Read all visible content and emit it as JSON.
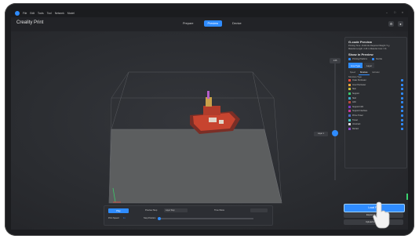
{
  "menubar": {
    "items": [
      "File",
      "Edit",
      "Tools",
      "Tool",
      "Network",
      "Model"
    ]
  },
  "toolbar": {
    "title": "Creality Print",
    "tabs": [
      {
        "label": "Prepare",
        "active": false
      },
      {
        "label": "Preview",
        "active": true
      },
      {
        "label": "Device",
        "active": false
      }
    ]
  },
  "side_panel": {
    "title": "G-code Preview",
    "info_line1": "Printing Time: 1h13m3s   Required Weight: 5.g",
    "info_line2": "Material Length: 2.26 m   Material Cost: 0 $",
    "show_title": "Show in Preview",
    "show_options": [
      {
        "label": "Printing Platform"
      },
      {
        "label": "Nozzle"
      }
    ],
    "scheme_tabs": [
      {
        "label": "Line Type",
        "active": true
      },
      {
        "label": "Layer",
        "active": false
      }
    ],
    "sub_tabs": [
      {
        "label": "Speed",
        "active": false
      },
      {
        "label": "Structure",
        "active": true
      },
      {
        "label": "Extruder",
        "active": false
      }
    ],
    "legend_header": "Structure Type",
    "legend": [
      {
        "label": "Outer Perimeter",
        "color": "#e84a3c"
      },
      {
        "label": "Inner Perimeter",
        "color": "#e8a23c"
      },
      {
        "label": "Skin",
        "color": "#c8c03c"
      },
      {
        "label": "Support",
        "color": "#3cc86a"
      },
      {
        "label": "Skirt",
        "color": "#3ca8c8"
      },
      {
        "label": "Infill",
        "color": "#b8483c"
      },
      {
        "label": "Support Infill",
        "color": "#7a3cc8"
      },
      {
        "label": "Support Interface",
        "color": "#c83c9a"
      },
      {
        "label": "Prime Tower",
        "color": "#4a6ac8"
      },
      {
        "label": "Travel",
        "color": "#3cc8c0"
      },
      {
        "label": "Unretract",
        "color": "#e0e0e0"
      },
      {
        "label": "Retract",
        "color": "#8a4ac8"
      }
    ]
  },
  "vslider": {
    "top_label": "1.06",
    "layer_label": "Layer 1"
  },
  "bottom_panel": {
    "play_label": "Play",
    "preview_step_label": "Preview Step",
    "preview_step_value": "Layer Step",
    "step_time_label": "Time Show",
    "step_time_value": "",
    "speed_label": "Print Speed",
    "speed_value": "1x",
    "step_position_label": "Step Position"
  },
  "actions": {
    "export_label": "Local Print",
    "second_label": "Export G-code",
    "third_label": "Upload to Cloud"
  }
}
